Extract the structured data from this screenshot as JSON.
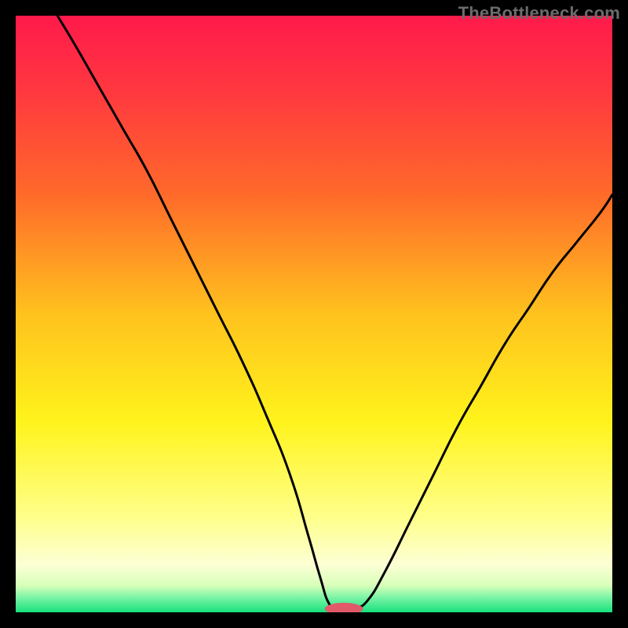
{
  "watermark": "TheBottleneck.com",
  "chart_data": {
    "type": "line",
    "title": "",
    "xlabel": "",
    "ylabel": "",
    "xlim": [
      0,
      100
    ],
    "ylim": [
      0,
      100
    ],
    "gradient_stops": [
      {
        "pos": 0.0,
        "color": "#ff1a4b"
      },
      {
        "pos": 0.12,
        "color": "#ff3640"
      },
      {
        "pos": 0.3,
        "color": "#ff6a2a"
      },
      {
        "pos": 0.5,
        "color": "#ffc21e"
      },
      {
        "pos": 0.68,
        "color": "#fff31c"
      },
      {
        "pos": 0.84,
        "color": "#ffff8a"
      },
      {
        "pos": 0.92,
        "color": "#fcffd4"
      },
      {
        "pos": 0.955,
        "color": "#d8ffba"
      },
      {
        "pos": 0.975,
        "color": "#7cf4a6"
      },
      {
        "pos": 1.0,
        "color": "#17e07d"
      }
    ],
    "series": [
      {
        "name": "bottleneck-curve",
        "color": "#000000",
        "x": [
          7,
          10,
          14,
          18,
          22,
          26,
          30,
          34,
          38,
          42,
          46,
          49,
          51,
          52.5,
          54,
          55,
          56,
          57,
          59,
          62,
          66,
          70,
          74,
          78,
          82,
          86,
          90,
          94,
          98,
          100
        ],
        "y": [
          100,
          95,
          88,
          81,
          74,
          66,
          58,
          50,
          42,
          33,
          23,
          13,
          6,
          1.5,
          0.5,
          0.5,
          0.6,
          0.8,
          2,
          7,
          15,
          23,
          31,
          38,
          45,
          51,
          57,
          62,
          67,
          70
        ]
      }
    ],
    "marker": {
      "name": "optimal-marker",
      "cx": 55,
      "cy": 0.6,
      "rx": 3.2,
      "ry": 1.0,
      "color": "#e05a6a"
    }
  }
}
